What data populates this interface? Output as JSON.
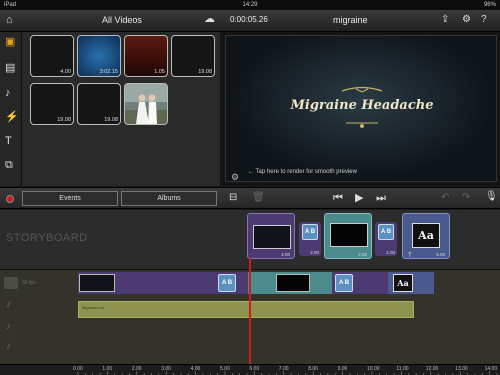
{
  "status": {
    "carrier": "iPad",
    "time": "14:29",
    "battery": "96%"
  },
  "header": {
    "browser_title": "All Videos",
    "timecode": "0:00:05.26",
    "project_title": "migraine"
  },
  "clips": [
    {
      "duration": "4.00"
    },
    {
      "duration": "3:02.15"
    },
    {
      "duration": "1.05"
    },
    {
      "duration": "19.08"
    },
    {
      "duration": "19.08"
    },
    {
      "duration": "19.08"
    },
    {
      "duration": ""
    }
  ],
  "preview": {
    "title": "Migraine Headache",
    "hint": "← Tap here to render for smooth preview"
  },
  "controls": {
    "events_tab": "Events",
    "albums_tab": "Albums"
  },
  "storyboard": {
    "label": "STORYBOARD",
    "items": [
      {
        "duration": "4.00"
      },
      {
        "duration": "2.00"
      },
      {
        "duration": "2.00"
      },
      {
        "duration": "2.00"
      },
      {
        "duration": "5.00"
      }
    ],
    "title_glyph": "Aa"
  },
  "timeline": {
    "track_label": "30 fps",
    "ab_label": "A B",
    "title_glyph": "Aa",
    "audio_clip_label": "Migraine.caf",
    "ruler": [
      "0.00",
      "1.00",
      "2.00",
      "3.00",
      "4.00",
      "5.00",
      "6.00",
      "7.00",
      "8.00",
      "9.00",
      "10.00",
      "11.00",
      "12.00",
      "13.00",
      "14.00"
    ]
  },
  "colors": {
    "accent": "#e6a21c",
    "playhead": "#d21a1a",
    "video_track": "#4c3a73",
    "audio_track": "#8e9450",
    "transition": "#5c90c0"
  }
}
